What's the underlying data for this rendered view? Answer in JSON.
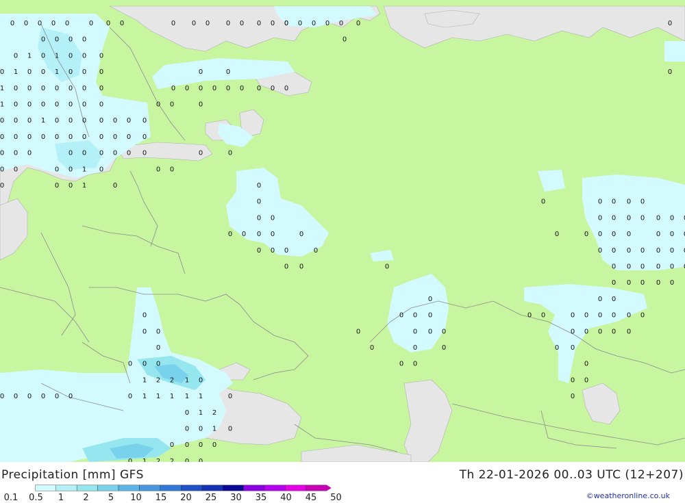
{
  "title": "Precipitation [mm] GFS",
  "timestamp": "Th 22-01-2026 00..03 UTC (12+207)",
  "credit": "©weatheronline.co.uk",
  "colors": {
    "land": "#c8f5a0",
    "sea": "#e6e6e6",
    "border": "#8a8a8a",
    "precip_light": "#d2faff"
  },
  "legend": {
    "labels": [
      "0.1",
      "0.5",
      "1",
      "2",
      "5",
      "10",
      "15",
      "20",
      "25",
      "30",
      "35",
      "40",
      "45",
      "50"
    ],
    "colors": [
      "#d2faff",
      "#b4f0f8",
      "#96e6f0",
      "#78d2ec",
      "#5ab4e6",
      "#4696e0",
      "#3278d8",
      "#2050c8",
      "#1432b4",
      "#0a0a96",
      "#8c00e6",
      "#b400f0",
      "#e600e6",
      "#c800b4"
    ]
  },
  "values": [
    [
      "0",
      0,
      15
    ],
    [
      "0",
      0,
      35
    ],
    [
      "0",
      0,
      55
    ],
    [
      "0",
      0,
      75
    ],
    [
      "0",
      0,
      95
    ],
    [
      "0",
      0,
      130
    ],
    [
      "0",
      0,
      155
    ],
    [
      "0",
      0,
      175
    ],
    [
      "0",
      0,
      250
    ],
    [
      "0",
      0,
      280
    ],
    [
      "0",
      0,
      300
    ],
    [
      "0",
      0,
      330
    ],
    [
      "0",
      0,
      350
    ],
    [
      "0",
      0,
      375
    ],
    [
      "0",
      0,
      395
    ],
    [
      "0",
      0,
      415
    ],
    [
      "0",
      0,
      415
    ],
    [
      "0",
      0,
      435
    ],
    [
      "0",
      0,
      455
    ],
    [
      "0",
      0,
      475
    ],
    [
      "0",
      0,
      495
    ],
    [
      "0",
      0,
      520
    ],
    [
      "0",
      0,
      975
    ],
    [
      "0",
      1,
      60
    ],
    [
      "0",
      1,
      80
    ],
    [
      "0",
      1,
      100
    ],
    [
      "0",
      1,
      120
    ],
    [
      "0",
      1,
      500
    ],
    [
      "0",
      2,
      20
    ],
    [
      "1",
      2,
      40
    ],
    [
      "0",
      2,
      60
    ],
    [
      "1",
      2,
      80
    ],
    [
      "0",
      2,
      100
    ],
    [
      "0",
      2,
      120
    ],
    [
      "0",
      2,
      145
    ],
    [
      "0",
      3,
      0
    ],
    [
      "1",
      3,
      20
    ],
    [
      "0",
      3,
      40
    ],
    [
      "0",
      3,
      60
    ],
    [
      "1",
      3,
      80
    ],
    [
      "0",
      3,
      100
    ],
    [
      "0",
      3,
      120
    ],
    [
      "0",
      3,
      145
    ],
    [
      "0",
      3,
      290
    ],
    [
      "0",
      3,
      330
    ],
    [
      "0",
      3,
      975
    ],
    [
      "1",
      4,
      0
    ],
    [
      "0",
      4,
      20
    ],
    [
      "0",
      4,
      40
    ],
    [
      "0",
      4,
      60
    ],
    [
      "0",
      4,
      80
    ],
    [
      "0",
      4,
      100
    ],
    [
      "0",
      4,
      120
    ],
    [
      "0",
      4,
      145
    ],
    [
      "0",
      4,
      250
    ],
    [
      "0",
      4,
      270
    ],
    [
      "0",
      4,
      290
    ],
    [
      "0",
      4,
      310
    ],
    [
      "0",
      4,
      330
    ],
    [
      "0",
      4,
      350
    ],
    [
      "0",
      4,
      375
    ],
    [
      "0",
      4,
      395
    ],
    [
      "0",
      4,
      415
    ],
    [
      "1",
      5,
      0
    ],
    [
      "0",
      5,
      20
    ],
    [
      "0",
      5,
      40
    ],
    [
      "0",
      5,
      60
    ],
    [
      "0",
      5,
      80
    ],
    [
      "0",
      5,
      100
    ],
    [
      "0",
      5,
      120
    ],
    [
      "0",
      5,
      145
    ],
    [
      "0",
      5,
      228
    ],
    [
      "0",
      5,
      248
    ],
    [
      "0",
      5,
      290
    ],
    [
      "0",
      6,
      0
    ],
    [
      "0",
      6,
      20
    ],
    [
      "0",
      6,
      40
    ],
    [
      "1",
      6,
      60
    ],
    [
      "0",
      6,
      80
    ],
    [
      "0",
      6,
      100
    ],
    [
      "0",
      6,
      120
    ],
    [
      "0",
      6,
      145
    ],
    [
      "0",
      6,
      165
    ],
    [
      "0",
      6,
      185
    ],
    [
      "0",
      6,
      208
    ],
    [
      "0",
      7,
      0
    ],
    [
      "0",
      7,
      20
    ],
    [
      "0",
      7,
      40
    ],
    [
      "0",
      7,
      60
    ],
    [
      "0",
      7,
      80
    ],
    [
      "0",
      7,
      100
    ],
    [
      "0",
      7,
      120
    ],
    [
      "0",
      7,
      145
    ],
    [
      "0",
      7,
      165
    ],
    [
      "0",
      7,
      185
    ],
    [
      "0",
      7,
      208
    ],
    [
      "0",
      8,
      0
    ],
    [
      "0",
      8,
      20
    ],
    [
      "0",
      8,
      40
    ],
    [
      "0",
      8,
      100
    ],
    [
      "0",
      8,
      120
    ],
    [
      "0",
      8,
      145
    ],
    [
      "0",
      8,
      165
    ],
    [
      "0",
      8,
      185
    ],
    [
      "0",
      8,
      208
    ],
    [
      "0",
      8,
      290
    ],
    [
      "0",
      8,
      333
    ],
    [
      "0",
      9,
      0
    ],
    [
      "0",
      9,
      20
    ],
    [
      "0",
      9,
      80
    ],
    [
      "0",
      9,
      100
    ],
    [
      "1",
      9,
      120
    ],
    [
      "0",
      9,
      145
    ],
    [
      "0",
      9,
      228
    ],
    [
      "0",
      9,
      248
    ],
    [
      "0",
      10,
      0
    ],
    [
      "0",
      10,
      80
    ],
    [
      "0",
      10,
      100
    ],
    [
      "1",
      10,
      120
    ],
    [
      "0",
      10,
      165
    ],
    [
      "0",
      10,
      375
    ],
    [
      "0",
      11,
      375
    ],
    [
      "0",
      11,
      790
    ],
    [
      "0",
      11,
      873
    ],
    [
      "0",
      11,
      893
    ],
    [
      "0",
      11,
      915
    ],
    [
      "0",
      11,
      935
    ],
    [
      "0",
      12,
      375
    ],
    [
      "0",
      12,
      395
    ],
    [
      "0",
      12,
      873
    ],
    [
      "0",
      12,
      893
    ],
    [
      "0",
      12,
      915
    ],
    [
      "0",
      12,
      935
    ],
    [
      "0",
      12,
      958
    ],
    [
      "0",
      12,
      978
    ],
    [
      "0",
      12,
      998
    ],
    [
      "0",
      13,
      333
    ],
    [
      "0",
      13,
      353
    ],
    [
      "0",
      13,
      375
    ],
    [
      "0",
      13,
      395
    ],
    [
      "0",
      13,
      437
    ],
    [
      "0",
      13,
      810
    ],
    [
      "0",
      13,
      853
    ],
    [
      "0",
      13,
      873
    ],
    [
      "0",
      13,
      893
    ],
    [
      "0",
      13,
      915
    ],
    [
      "0",
      13,
      958
    ],
    [
      "0",
      13,
      978
    ],
    [
      "0",
      13,
      998
    ],
    [
      "0",
      14,
      375
    ],
    [
      "0",
      14,
      395
    ],
    [
      "0",
      14,
      415
    ],
    [
      "0",
      14,
      458
    ],
    [
      "0",
      14,
      873
    ],
    [
      "0",
      14,
      893
    ],
    [
      "0",
      14,
      915
    ],
    [
      "0",
      14,
      935
    ],
    [
      "0",
      14,
      958
    ],
    [
      "0",
      14,
      978
    ],
    [
      "0",
      14,
      998
    ],
    [
      "0",
      15,
      415
    ],
    [
      "0",
      15,
      437
    ],
    [
      "0",
      15,
      562
    ],
    [
      "0",
      15,
      893
    ],
    [
      "0",
      15,
      915
    ],
    [
      "0",
      15,
      935
    ],
    [
      "0",
      15,
      958
    ],
    [
      "0",
      15,
      978
    ],
    [
      "0",
      15,
      998
    ],
    [
      "0",
      16,
      893
    ],
    [
      "0",
      16,
      915
    ],
    [
      "0",
      16,
      935
    ],
    [
      "0",
      16,
      958
    ],
    [
      "0",
      16,
      978
    ],
    [
      "0",
      17,
      625
    ],
    [
      "0",
      17,
      873
    ],
    [
      "0",
      17,
      893
    ],
    [
      "0",
      18,
      208
    ],
    [
      "0",
      18,
      583
    ],
    [
      "0",
      18,
      603
    ],
    [
      "0",
      18,
      625
    ],
    [
      "0",
      18,
      770
    ],
    [
      "0",
      18,
      790
    ],
    [
      "0",
      18,
      833
    ],
    [
      "0",
      18,
      853
    ],
    [
      "0",
      18,
      873
    ],
    [
      "0",
      18,
      893
    ],
    [
      "0",
      18,
      915
    ],
    [
      "0",
      18,
      935
    ],
    [
      "0",
      19,
      208
    ],
    [
      "0",
      19,
      228
    ],
    [
      "0",
      19,
      520
    ],
    [
      "0",
      19,
      603
    ],
    [
      "0",
      19,
      625
    ],
    [
      "0",
      19,
      645
    ],
    [
      "0",
      19,
      833
    ],
    [
      "0",
      19,
      853
    ],
    [
      "0",
      19,
      873
    ],
    [
      "0",
      19,
      893
    ],
    [
      "0",
      19,
      915
    ],
    [
      "0",
      20,
      228
    ],
    [
      "0",
      20,
      540
    ],
    [
      "0",
      20,
      603
    ],
    [
      "0",
      20,
      645
    ],
    [
      "0",
      20,
      810
    ],
    [
      "0",
      20,
      833
    ],
    [
      "0",
      21,
      187
    ],
    [
      "0",
      21,
      208
    ],
    [
      "0",
      21,
      228
    ],
    [
      "0",
      21,
      583
    ],
    [
      "0",
      21,
      603
    ],
    [
      "0",
      21,
      853
    ],
    [
      "1",
      22,
      208
    ],
    [
      "2",
      22,
      228
    ],
    [
      "2",
      22,
      248
    ],
    [
      "1",
      22,
      270
    ],
    [
      "0",
      22,
      290
    ],
    [
      "0",
      22,
      833
    ],
    [
      "0",
      22,
      853
    ],
    [
      "0",
      23,
      0
    ],
    [
      "0",
      23,
      20
    ],
    [
      "0",
      23,
      40
    ],
    [
      "0",
      23,
      60
    ],
    [
      "0",
      23,
      80
    ],
    [
      "0",
      23,
      100
    ],
    [
      "0",
      23,
      187
    ],
    [
      "1",
      23,
      208
    ],
    [
      "1",
      23,
      228
    ],
    [
      "1",
      23,
      248
    ],
    [
      "1",
      23,
      270
    ],
    [
      "1",
      23,
      290
    ],
    [
      "0",
      23,
      333
    ],
    [
      "0",
      23,
      833
    ],
    [
      "0",
      24,
      270
    ],
    [
      "1",
      24,
      290
    ],
    [
      "2",
      24,
      310
    ],
    [
      "0",
      25,
      270
    ],
    [
      "0",
      25,
      290
    ],
    [
      "1",
      25,
      310
    ],
    [
      "0",
      25,
      333
    ],
    [
      "0",
      26,
      248
    ],
    [
      "0",
      26,
      270
    ],
    [
      "0",
      26,
      290
    ],
    [
      "0",
      26,
      310
    ],
    [
      "0",
      27,
      187
    ],
    [
      "1",
      27,
      208
    ],
    [
      "2",
      27,
      228
    ],
    [
      "2",
      27,
      248
    ],
    [
      "0",
      27,
      270
    ],
    [
      "0",
      27,
      290
    ]
  ]
}
